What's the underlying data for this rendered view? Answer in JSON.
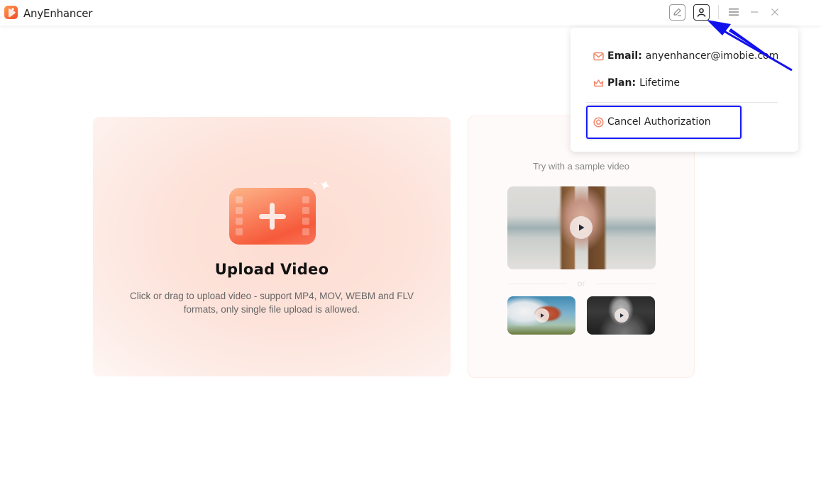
{
  "app": {
    "title": "AnyEnhancer",
    "brand_color": "#f4562e"
  },
  "titlebar": {
    "icons": [
      "edit-feedback-icon",
      "user-account-icon",
      "menu-icon",
      "minimize-icon",
      "close-icon"
    ]
  },
  "upload": {
    "title": "Upload Video",
    "description": "Click or drag to upload video - support MP4, MOV, WEBM and FLV formats, only single file upload is allowed.",
    "icon": "video-add-icon"
  },
  "samples": {
    "label": "Try with a sample video",
    "or_text": "or",
    "videos": [
      {
        "name": "woman-on-beach",
        "icon": "play-icon"
      },
      {
        "name": "mushroom-house",
        "icon": "play-icon"
      },
      {
        "name": "man-black-and-white",
        "icon": "play-icon"
      }
    ]
  },
  "account_popup": {
    "email_label": "Email:",
    "email_value": "anyenhancer@imobie.com",
    "plan_label": "Plan:",
    "plan_value": "Lifetime",
    "cancel_label": "Cancel Authorization",
    "accent_color": "#f0866a"
  },
  "annotation": {
    "highlight_color": "#1a1aff"
  }
}
